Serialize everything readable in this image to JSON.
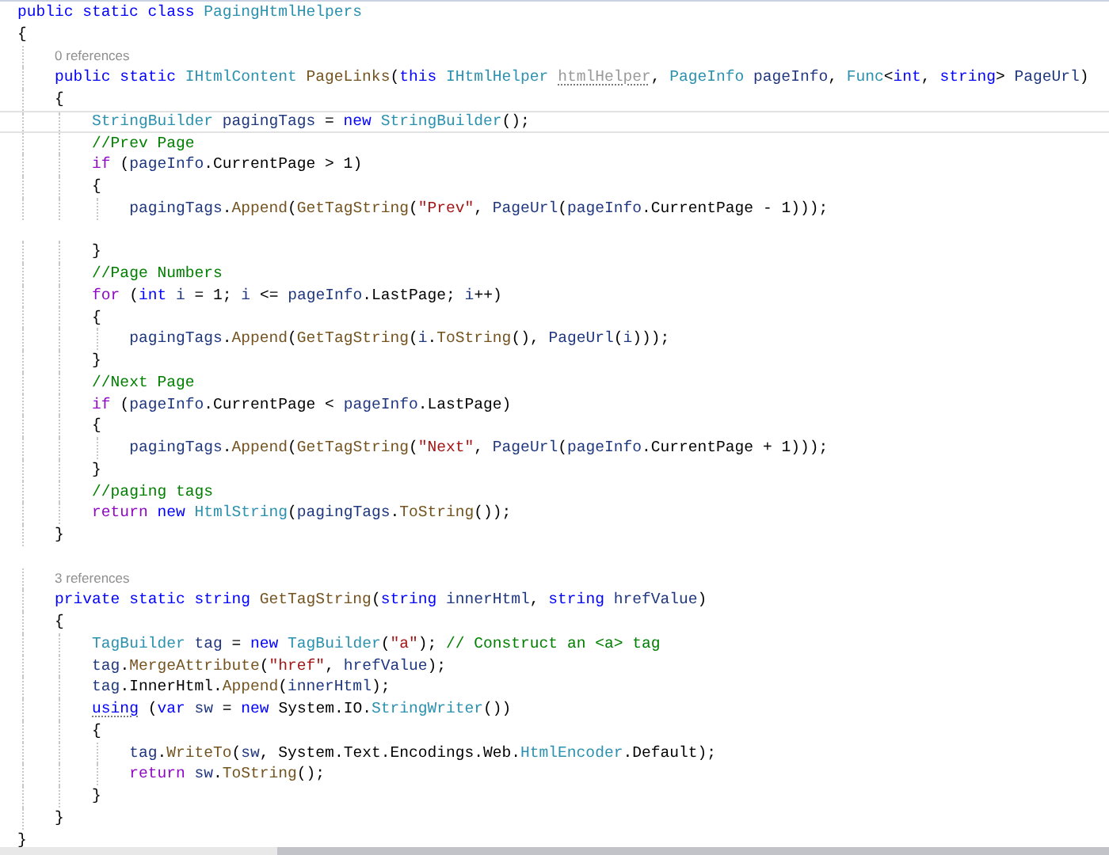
{
  "editor": {
    "lines": [
      {
        "kind": "code",
        "current": false,
        "tokens": [
          {
            "kind": "kw",
            "text": "public static class "
          },
          {
            "kind": "type",
            "text": "PagingHtmlHelpers"
          }
        ]
      },
      {
        "kind": "code",
        "current": false,
        "tokens": [
          {
            "kind": "plain",
            "text": "{"
          }
        ]
      },
      {
        "kind": "lens",
        "text": "0 references"
      },
      {
        "kind": "code",
        "current": false,
        "tokens": [
          {
            "kind": "kw",
            "text": "    public static "
          },
          {
            "kind": "type",
            "text": "IHtmlContent "
          },
          {
            "kind": "method",
            "text": "PageLinks"
          },
          {
            "kind": "plain",
            "text": "("
          },
          {
            "kind": "kw",
            "text": "this "
          },
          {
            "kind": "type",
            "text": "IHtmlHelper "
          },
          {
            "kind": "unused",
            "text": "htmlHelper",
            "hint": true
          },
          {
            "kind": "plain",
            "text": ", "
          },
          {
            "kind": "type",
            "text": "PageInfo "
          },
          {
            "kind": "var",
            "text": "pageInfo"
          },
          {
            "kind": "plain",
            "text": ", "
          },
          {
            "kind": "type",
            "text": "Func"
          },
          {
            "kind": "plain",
            "text": "<"
          },
          {
            "kind": "kw",
            "text": "int"
          },
          {
            "kind": "plain",
            "text": ", "
          },
          {
            "kind": "kw",
            "text": "string"
          },
          {
            "kind": "plain",
            "text": "> "
          },
          {
            "kind": "var",
            "text": "PageUrl"
          },
          {
            "kind": "plain",
            "text": ")"
          }
        ]
      },
      {
        "kind": "code",
        "current": false,
        "tokens": [
          {
            "kind": "plain",
            "text": "    {"
          }
        ]
      },
      {
        "kind": "code",
        "current": true,
        "tokens": [
          {
            "kind": "type",
            "text": "        StringBuilder "
          },
          {
            "kind": "var",
            "text": "pagingTags "
          },
          {
            "kind": "plain",
            "text": "= "
          },
          {
            "kind": "kw",
            "text": "new "
          },
          {
            "kind": "type",
            "text": "StringBuilder"
          },
          {
            "kind": "plain",
            "text": "();"
          }
        ]
      },
      {
        "kind": "code",
        "current": false,
        "tokens": [
          {
            "kind": "cmt",
            "text": "        //Prev Page"
          }
        ]
      },
      {
        "kind": "code",
        "current": false,
        "tokens": [
          {
            "kind": "ctl",
            "text": "        if "
          },
          {
            "kind": "plain",
            "text": "("
          },
          {
            "kind": "var",
            "text": "pageInfo"
          },
          {
            "kind": "plain",
            "text": ".CurrentPage > 1)"
          }
        ]
      },
      {
        "kind": "code",
        "current": false,
        "tokens": [
          {
            "kind": "plain",
            "text": "        {"
          }
        ]
      },
      {
        "kind": "code",
        "current": false,
        "tokens": [
          {
            "kind": "var",
            "text": "            pagingTags"
          },
          {
            "kind": "plain",
            "text": "."
          },
          {
            "kind": "method",
            "text": "Append"
          },
          {
            "kind": "plain",
            "text": "("
          },
          {
            "kind": "method",
            "text": "GetTagString"
          },
          {
            "kind": "plain",
            "text": "("
          },
          {
            "kind": "str",
            "text": "\"Prev\""
          },
          {
            "kind": "plain",
            "text": ", "
          },
          {
            "kind": "var",
            "text": "PageUrl"
          },
          {
            "kind": "plain",
            "text": "("
          },
          {
            "kind": "var",
            "text": "pageInfo"
          },
          {
            "kind": "plain",
            "text": ".CurrentPage - 1)));"
          }
        ]
      },
      {
        "kind": "blank"
      },
      {
        "kind": "code",
        "current": false,
        "tokens": [
          {
            "kind": "plain",
            "text": "        }"
          }
        ]
      },
      {
        "kind": "code",
        "current": false,
        "tokens": [
          {
            "kind": "cmt",
            "text": "        //Page Numbers"
          }
        ]
      },
      {
        "kind": "code",
        "current": false,
        "tokens": [
          {
            "kind": "ctl",
            "text": "        for "
          },
          {
            "kind": "plain",
            "text": "("
          },
          {
            "kind": "kw",
            "text": "int "
          },
          {
            "kind": "var",
            "text": "i "
          },
          {
            "kind": "plain",
            "text": "= 1; "
          },
          {
            "kind": "var",
            "text": "i "
          },
          {
            "kind": "plain",
            "text": "<= "
          },
          {
            "kind": "var",
            "text": "pageInfo"
          },
          {
            "kind": "plain",
            "text": ".LastPage; "
          },
          {
            "kind": "var",
            "text": "i"
          },
          {
            "kind": "plain",
            "text": "++)"
          }
        ]
      },
      {
        "kind": "code",
        "current": false,
        "tokens": [
          {
            "kind": "plain",
            "text": "        {"
          }
        ]
      },
      {
        "kind": "code",
        "current": false,
        "tokens": [
          {
            "kind": "var",
            "text": "            pagingTags"
          },
          {
            "kind": "plain",
            "text": "."
          },
          {
            "kind": "method",
            "text": "Append"
          },
          {
            "kind": "plain",
            "text": "("
          },
          {
            "kind": "method",
            "text": "GetTagString"
          },
          {
            "kind": "plain",
            "text": "("
          },
          {
            "kind": "var",
            "text": "i"
          },
          {
            "kind": "plain",
            "text": "."
          },
          {
            "kind": "method",
            "text": "ToString"
          },
          {
            "kind": "plain",
            "text": "(), "
          },
          {
            "kind": "var",
            "text": "PageUrl"
          },
          {
            "kind": "plain",
            "text": "("
          },
          {
            "kind": "var",
            "text": "i"
          },
          {
            "kind": "plain",
            "text": ")));"
          }
        ]
      },
      {
        "kind": "code",
        "current": false,
        "tokens": [
          {
            "kind": "plain",
            "text": "        }"
          }
        ]
      },
      {
        "kind": "code",
        "current": false,
        "tokens": [
          {
            "kind": "cmt",
            "text": "        //Next Page"
          }
        ]
      },
      {
        "kind": "code",
        "current": false,
        "tokens": [
          {
            "kind": "ctl",
            "text": "        if "
          },
          {
            "kind": "plain",
            "text": "("
          },
          {
            "kind": "var",
            "text": "pageInfo"
          },
          {
            "kind": "plain",
            "text": ".CurrentPage < "
          },
          {
            "kind": "var",
            "text": "pageInfo"
          },
          {
            "kind": "plain",
            "text": ".LastPage)"
          }
        ]
      },
      {
        "kind": "code",
        "current": false,
        "tokens": [
          {
            "kind": "plain",
            "text": "        {"
          }
        ]
      },
      {
        "kind": "code",
        "current": false,
        "tokens": [
          {
            "kind": "var",
            "text": "            pagingTags"
          },
          {
            "kind": "plain",
            "text": "."
          },
          {
            "kind": "method",
            "text": "Append"
          },
          {
            "kind": "plain",
            "text": "("
          },
          {
            "kind": "method",
            "text": "GetTagString"
          },
          {
            "kind": "plain",
            "text": "("
          },
          {
            "kind": "str",
            "text": "\"Next\""
          },
          {
            "kind": "plain",
            "text": ", "
          },
          {
            "kind": "var",
            "text": "PageUrl"
          },
          {
            "kind": "plain",
            "text": "("
          },
          {
            "kind": "var",
            "text": "pageInfo"
          },
          {
            "kind": "plain",
            "text": ".CurrentPage + 1)));"
          }
        ]
      },
      {
        "kind": "code",
        "current": false,
        "tokens": [
          {
            "kind": "plain",
            "text": "        }"
          }
        ]
      },
      {
        "kind": "code",
        "current": false,
        "tokens": [
          {
            "kind": "cmt",
            "text": "        //paging tags"
          }
        ]
      },
      {
        "kind": "code",
        "current": false,
        "tokens": [
          {
            "kind": "ctl",
            "text": "        return "
          },
          {
            "kind": "kw",
            "text": "new "
          },
          {
            "kind": "type",
            "text": "HtmlString"
          },
          {
            "kind": "plain",
            "text": "("
          },
          {
            "kind": "var",
            "text": "pagingTags"
          },
          {
            "kind": "plain",
            "text": "."
          },
          {
            "kind": "method",
            "text": "ToString"
          },
          {
            "kind": "plain",
            "text": "());"
          }
        ]
      },
      {
        "kind": "code",
        "current": false,
        "tokens": [
          {
            "kind": "plain",
            "text": "    }"
          }
        ]
      },
      {
        "kind": "blank"
      },
      {
        "kind": "lens",
        "text": "3 references"
      },
      {
        "kind": "code",
        "current": false,
        "tokens": [
          {
            "kind": "kw",
            "text": "    private static string "
          },
          {
            "kind": "method",
            "text": "GetTagString"
          },
          {
            "kind": "plain",
            "text": "("
          },
          {
            "kind": "kw",
            "text": "string "
          },
          {
            "kind": "var",
            "text": "innerHtml"
          },
          {
            "kind": "plain",
            "text": ", "
          },
          {
            "kind": "kw",
            "text": "string "
          },
          {
            "kind": "var",
            "text": "hrefValue"
          },
          {
            "kind": "plain",
            "text": ")"
          }
        ]
      },
      {
        "kind": "code",
        "current": false,
        "tokens": [
          {
            "kind": "plain",
            "text": "    {"
          }
        ]
      },
      {
        "kind": "code",
        "current": false,
        "tokens": [
          {
            "kind": "type",
            "text": "        TagBuilder "
          },
          {
            "kind": "var",
            "text": "tag "
          },
          {
            "kind": "plain",
            "text": "= "
          },
          {
            "kind": "kw",
            "text": "new "
          },
          {
            "kind": "type",
            "text": "TagBuilder"
          },
          {
            "kind": "plain",
            "text": "("
          },
          {
            "kind": "str",
            "text": "\"a\""
          },
          {
            "kind": "plain",
            "text": "); "
          },
          {
            "kind": "cmt",
            "text": "// Construct an <a> tag"
          }
        ]
      },
      {
        "kind": "code",
        "current": false,
        "tokens": [
          {
            "kind": "var",
            "text": "        tag"
          },
          {
            "kind": "plain",
            "text": "."
          },
          {
            "kind": "method",
            "text": "MergeAttribute"
          },
          {
            "kind": "plain",
            "text": "("
          },
          {
            "kind": "str",
            "text": "\"href\""
          },
          {
            "kind": "plain",
            "text": ", "
          },
          {
            "kind": "var",
            "text": "hrefValue"
          },
          {
            "kind": "plain",
            "text": ");"
          }
        ]
      },
      {
        "kind": "code",
        "current": false,
        "tokens": [
          {
            "kind": "var",
            "text": "        tag"
          },
          {
            "kind": "plain",
            "text": ".InnerHtml."
          },
          {
            "kind": "method",
            "text": "Append"
          },
          {
            "kind": "plain",
            "text": "("
          },
          {
            "kind": "var",
            "text": "innerHtml"
          },
          {
            "kind": "plain",
            "text": ");"
          }
        ]
      },
      {
        "kind": "code",
        "current": false,
        "tokens": [
          {
            "kind": "kw",
            "text": "        using",
            "hint": true
          },
          {
            "kind": "plain",
            "text": " ("
          },
          {
            "kind": "kw",
            "text": "var "
          },
          {
            "kind": "var",
            "text": "sw "
          },
          {
            "kind": "plain",
            "text": "= "
          },
          {
            "kind": "kw",
            "text": "new "
          },
          {
            "kind": "plain",
            "text": "System.IO."
          },
          {
            "kind": "type",
            "text": "StringWriter"
          },
          {
            "kind": "plain",
            "text": "())"
          }
        ]
      },
      {
        "kind": "code",
        "current": false,
        "tokens": [
          {
            "kind": "plain",
            "text": "        {"
          }
        ]
      },
      {
        "kind": "code",
        "current": false,
        "tokens": [
          {
            "kind": "var",
            "text": "            tag"
          },
          {
            "kind": "plain",
            "text": "."
          },
          {
            "kind": "method",
            "text": "WriteTo"
          },
          {
            "kind": "plain",
            "text": "("
          },
          {
            "kind": "var",
            "text": "sw"
          },
          {
            "kind": "plain",
            "text": ", System.Text.Encodings.Web."
          },
          {
            "kind": "type",
            "text": "HtmlEncoder"
          },
          {
            "kind": "plain",
            "text": ".Default);"
          }
        ]
      },
      {
        "kind": "code",
        "current": false,
        "tokens": [
          {
            "kind": "ctl",
            "text": "            return "
          },
          {
            "kind": "var",
            "text": "sw"
          },
          {
            "kind": "plain",
            "text": "."
          },
          {
            "kind": "method",
            "text": "ToString"
          },
          {
            "kind": "plain",
            "text": "();"
          }
        ]
      },
      {
        "kind": "code",
        "current": false,
        "tokens": [
          {
            "kind": "plain",
            "text": "        }"
          }
        ]
      },
      {
        "kind": "code",
        "current": false,
        "tokens": [
          {
            "kind": "plain",
            "text": "    }"
          }
        ]
      },
      {
        "kind": "code",
        "current": false,
        "tokens": [
          {
            "kind": "plain",
            "text": "}"
          }
        ]
      }
    ]
  }
}
